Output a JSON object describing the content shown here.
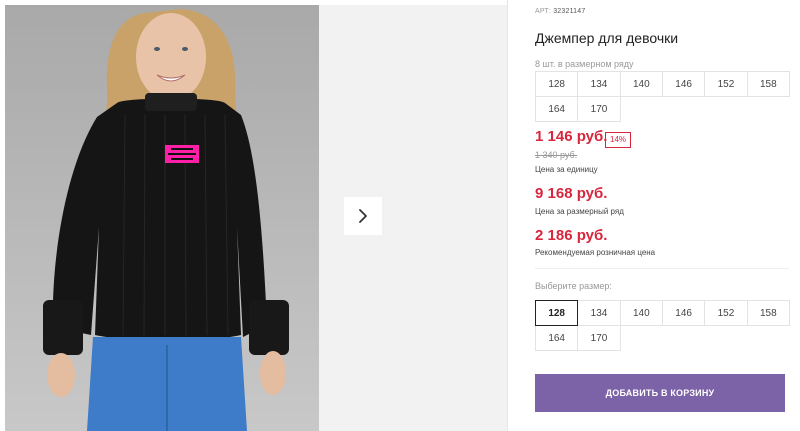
{
  "product": {
    "article_label": "АРТ:",
    "article_number": "32321147",
    "title": "Джемпер для девочки",
    "pack_label": "8 шт. в размерном ряду",
    "pack_sizes": [
      "128",
      "134",
      "140",
      "146",
      "152",
      "158",
      "164",
      "170"
    ],
    "badge_text": "ONLY FANTASTIC PLANET"
  },
  "pricing": {
    "unit_price": "1 146 руб.",
    "discount": "14%",
    "old_price": "1 340 руб.",
    "unit_label": "Цена за единицу",
    "pack_price": "9 168 руб.",
    "pack_price_label": "Цена за размерный ряд",
    "retail_price": "2 186 руб.",
    "retail_label": "Рекомендуемая розничная цена"
  },
  "size_select": {
    "label": "Выберите размер:",
    "options": [
      "128",
      "134",
      "140",
      "146",
      "152",
      "158",
      "164",
      "170"
    ],
    "selected": "128"
  },
  "cart_button_label": "ДОБАВИТЬ В КОРЗИНУ",
  "colors": {
    "price": "#d7263d",
    "button": "#7c62a6",
    "badge_pink": "#ff1fa6"
  },
  "icons": {
    "next": "chevron-right-icon"
  }
}
